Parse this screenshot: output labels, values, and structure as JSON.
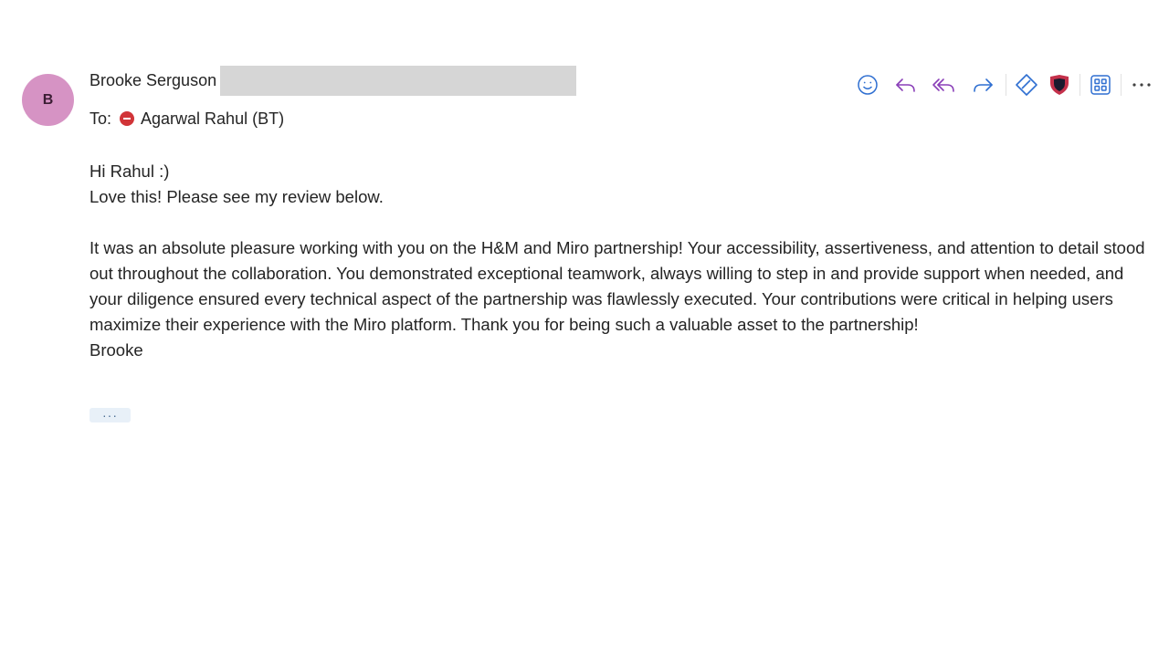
{
  "sender": {
    "avatar_initial": "B",
    "avatar_color": "#d693c4",
    "name": "Brooke Serguson"
  },
  "recipients": {
    "to_label": "To:",
    "to_name": "Agarwal Rahul (BT)",
    "status_icon": "blocked-icon"
  },
  "toolbar": {
    "icons": [
      "emoji-icon",
      "reply-icon",
      "reply-all-icon",
      "forward-icon",
      "diamond-icon",
      "shield-icon",
      "apps-icon",
      "more-icon"
    ],
    "accent_colors": {
      "blue": "#2f6fd1",
      "purple": "#8a3fb8",
      "shield": "#c4314b"
    }
  },
  "message": {
    "greeting": "Hi Rahul :)",
    "intro": "Love this! Please see my review below.",
    "review": "It was an absolute pleasure working with you on the H&M and Miro partnership! Your accessibility, assertiveness, and attention to detail stood out throughout the collaboration. You demonstrated exceptional teamwork, always willing to step in and provide support when needed, and your diligence ensured every technical aspect of the partnership was flawlessly executed. Your contributions were critical in helping users maximize their experience with the Miro platform. Thank you for being such a valuable asset to the partnership!",
    "signature": "Brooke",
    "expand_label": "···"
  }
}
